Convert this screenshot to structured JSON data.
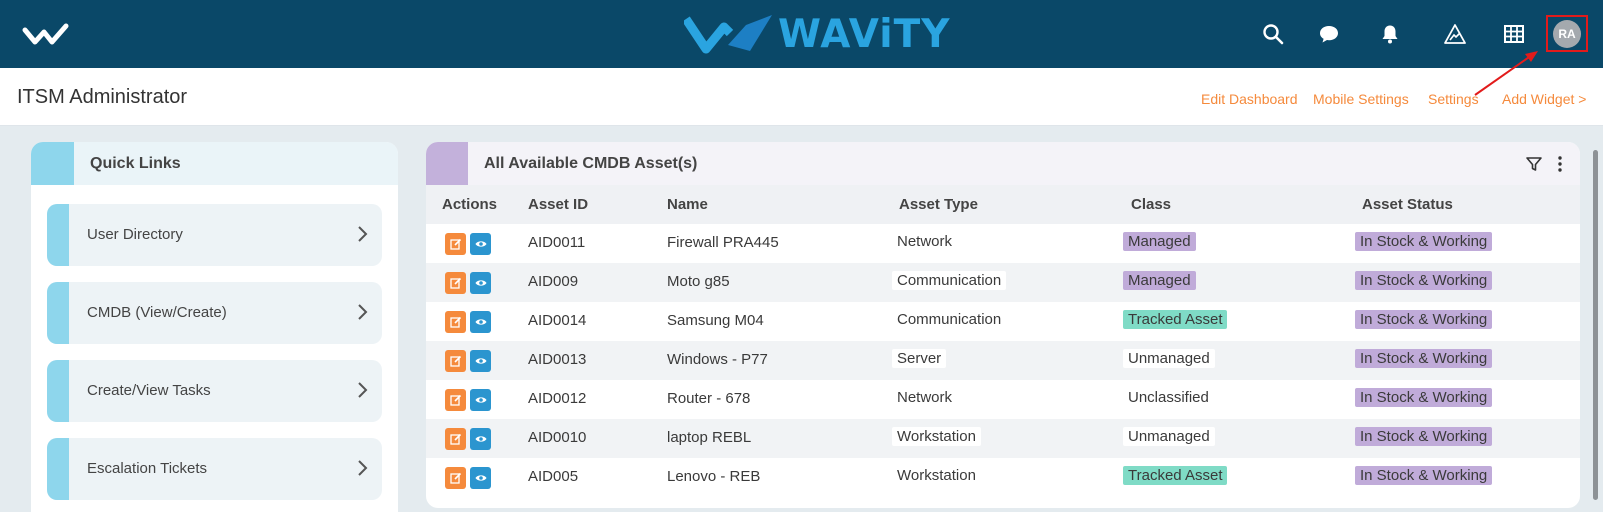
{
  "brand": {
    "name": "WAViTY",
    "logo_color": "#2aa4e0"
  },
  "top_icons": [
    "search-icon",
    "chat-icon",
    "bell-icon",
    "triangle-alert-icon",
    "grid-icon"
  ],
  "user": {
    "initials": "RA"
  },
  "subheader": {
    "title": "ITSM Administrator",
    "links": {
      "edit_dashboard": "Edit Dashboard",
      "mobile_settings": "Mobile Settings",
      "settings": "Settings",
      "add_widget": "Add Widget >"
    }
  },
  "quick_links": {
    "title": "Quick Links",
    "items": [
      {
        "label": "User Directory"
      },
      {
        "label": "CMDB (View/Create)"
      },
      {
        "label": "Create/View Tasks"
      },
      {
        "label": "Escalation Tickets"
      }
    ]
  },
  "cmdb": {
    "title": "All Available CMDB Asset(s)",
    "columns": [
      "Actions",
      "Asset ID",
      "Name",
      "Asset Type",
      "Class",
      "Asset Status"
    ],
    "rows": [
      {
        "asset_id": "AID0011",
        "name": "Firewall PRA445",
        "type": "Network",
        "class": "Managed",
        "class_style": "purple",
        "status": "In Stock & Working"
      },
      {
        "asset_id": "AID009",
        "name": "Moto g85",
        "type": "Communication",
        "class": "Managed",
        "class_style": "purple",
        "status": "In Stock & Working"
      },
      {
        "asset_id": "AID0014",
        "name": "Samsung M04",
        "type": "Communication",
        "class": "Tracked Asset",
        "class_style": "green",
        "status": "In Stock & Working"
      },
      {
        "asset_id": "AID0013",
        "name": "Windows - P77",
        "type": "Server",
        "class": "Unmanaged",
        "class_style": "white",
        "status": "In Stock & Working"
      },
      {
        "asset_id": "AID0012",
        "name": "Router - 678",
        "type": "Network",
        "class": "Unclassified",
        "class_style": "white",
        "status": "In Stock & Working"
      },
      {
        "asset_id": "AID0010",
        "name": "laptop REBL",
        "type": "Workstation",
        "class": "Unmanaged",
        "class_style": "white",
        "status": "In Stock & Working"
      },
      {
        "asset_id": "AID005",
        "name": "Lenovo - REB",
        "type": "Workstation",
        "class": "Tracked Asset",
        "class_style": "green",
        "status": "In Stock & Working"
      }
    ]
  },
  "colors": {
    "topbar": "#0a4868",
    "accent_orange": "#f58a3c",
    "accent_blue": "#2b95cf",
    "chip_purple": "#c0abd9",
    "chip_green": "#7fdbc6",
    "annotation_red": "#e21b1b"
  }
}
